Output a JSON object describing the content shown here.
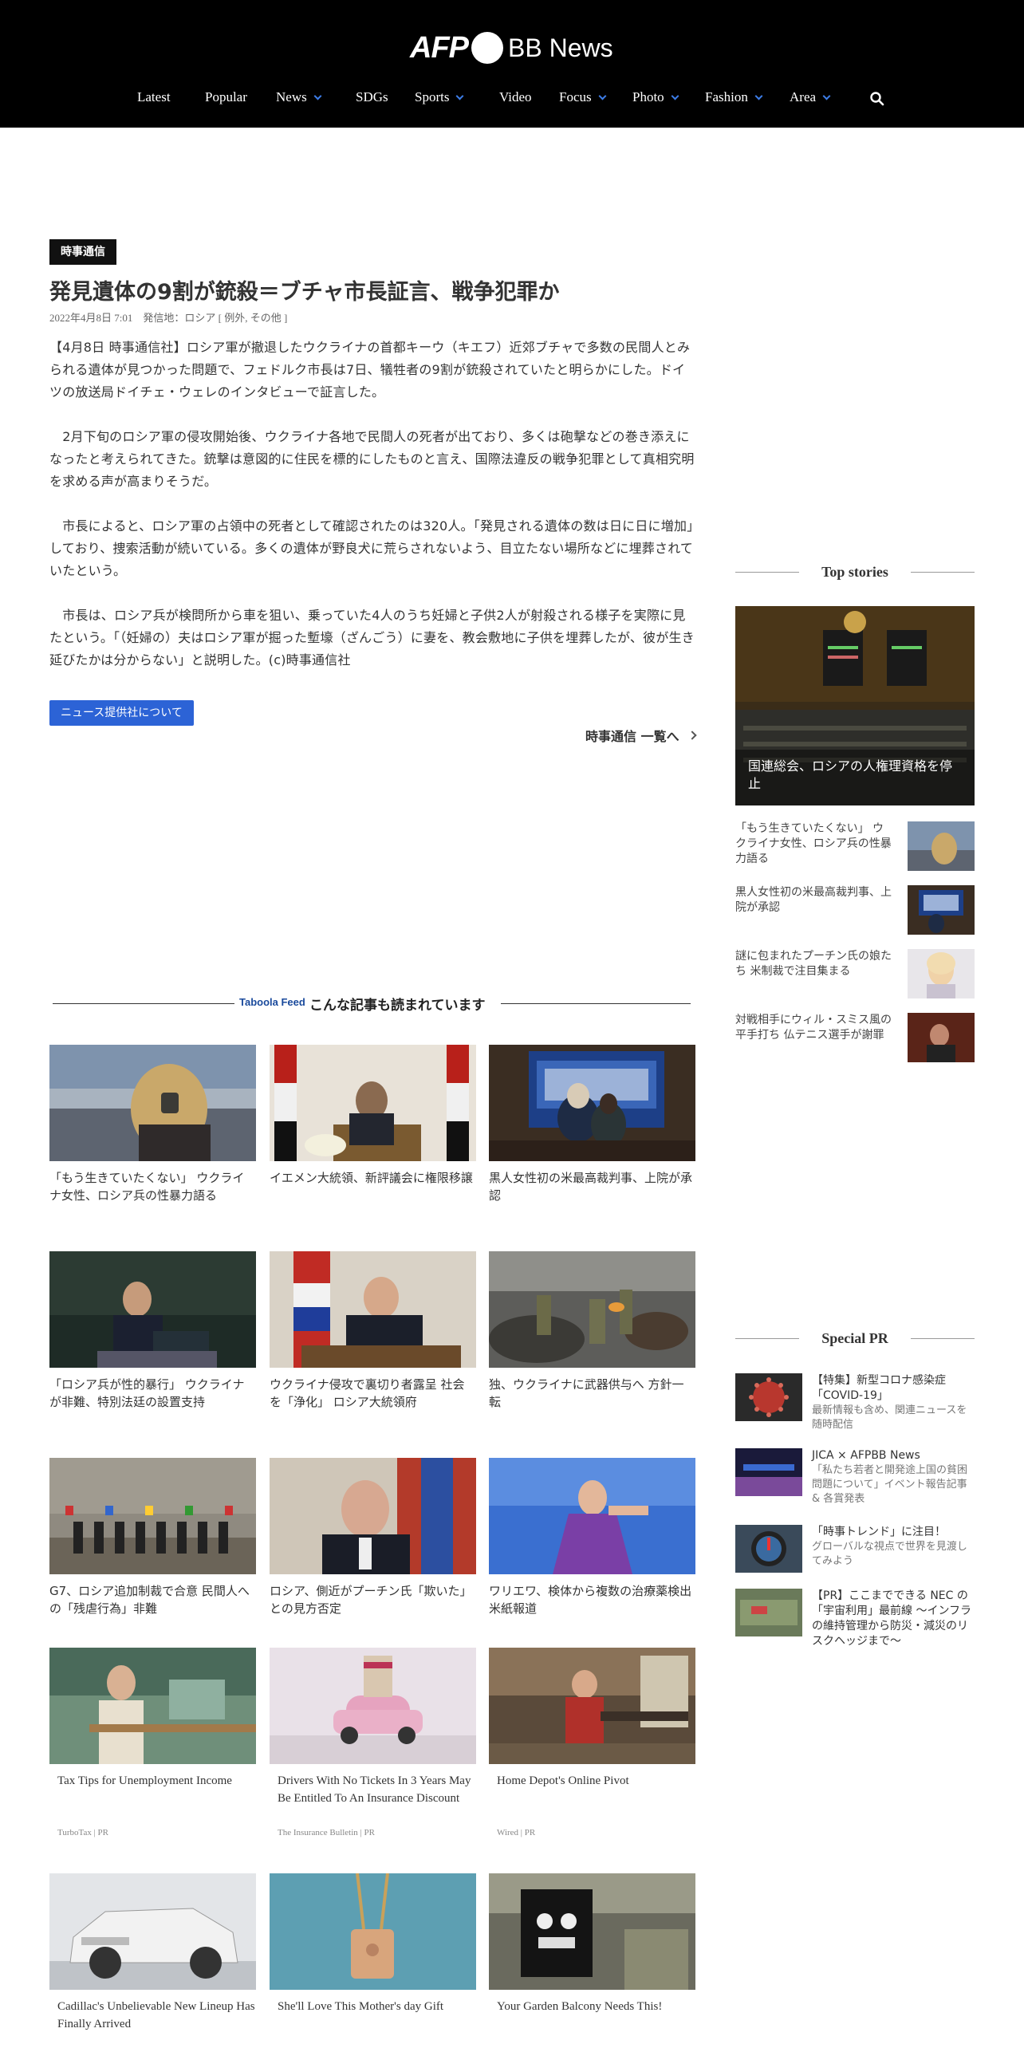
{
  "header": {
    "logo_afp": "AFP",
    "logo_bb": "BB News",
    "nav": [
      {
        "label": "Latest",
        "dropdown": false
      },
      {
        "label": "Popular",
        "dropdown": false
      },
      {
        "label": "News",
        "dropdown": true
      },
      {
        "label": "SDGs",
        "dropdown": false
      },
      {
        "label": "Sports",
        "dropdown": true
      },
      {
        "label": "Video",
        "dropdown": false
      },
      {
        "label": "Focus",
        "dropdown": true
      },
      {
        "label": "Photo",
        "dropdown": true
      },
      {
        "label": "Fashion",
        "dropdown": true
      },
      {
        "label": "Area",
        "dropdown": true
      }
    ],
    "search_icon": "search-icon"
  },
  "article": {
    "badge": "時事通信",
    "title": "発見遺体の9割が銃殺＝ブチャ市長証言、戦争犯罪か",
    "meta": "2022年4月8日 7:01　発信地：ロシア [ 例外, その他 ]",
    "paragraphs": [
      "【4月8日 時事通信社】ロシア軍が撤退したウクライナの首都キーウ（キエフ）近郊ブチャで多数の民間人とみられる遺体が見つかった問題で、フェドルク市長は7日、犠牲者の9割が銃殺されていたと明らかにした。ドイツの放送局ドイチェ・ウェレのインタビューで証言した。",
      "　2月下旬のロシア軍の侵攻開始後、ウクライナ各地で民間人の死者が出ており、多くは砲撃などの巻き添えになったと考えられてきた。銃撃は意図的に住民を標的にしたものと言え、国際法違反の戦争犯罪として真相究明を求める声が高まりそうだ。",
      "　市長によると、ロシア軍の占領中の死者として確認されたのは320人。「発見される遺体の数は日に日に増加」しており、捜索活動が続いている。多くの遺体が野良犬に荒らされないよう、目立たない場所などに埋葬されていたという。",
      "　市長は、ロシア兵が検問所から車を狙い、乗っていた4人のうち妊婦と子供2人が射殺される様子を実際に見たという。「（妊婦の）夫はロシア軍が掘った塹壕（ざんごう）に妻を、教会敷地に子供を埋葬したが、彼が生き延びたかは分からない」と説明した。(c)時事通信社"
    ],
    "provider_button": "ニュース提供社について",
    "more_link": "時事通信 一覧へ"
  },
  "taboola": {
    "logo": "Taboola Feed",
    "title": "こんな記事も読まれています",
    "cards": [
      {
        "caption": "「もう生きていたくない」 ウクライナ女性、ロシア兵の性暴力語る"
      },
      {
        "caption": "イエメン大統領、新評議会に権限移譲"
      },
      {
        "caption": "黒人女性初の米最高裁判事、上院が承認"
      },
      {
        "caption": "「ロシア兵が性的暴行」 ウクライナが非難、特別法廷の設置支持"
      },
      {
        "caption": "ウクライナ侵攻で裏切り者露呈 社会を「浄化」 ロシア大統領府"
      },
      {
        "caption": "独、ウクライナに武器供与へ 方針一転"
      },
      {
        "caption": "G7、ロシア追加制裁で合意 民間人への「残虐行為」非難"
      },
      {
        "caption": "ロシア、側近がプーチン氏「欺いた」との見方否定"
      },
      {
        "caption": "ワリエワ、検体から複数の治療薬検出 米紙報道"
      },
      {
        "caption": "Tax Tips for Unemployment Income",
        "source": "TurboTax | PR"
      },
      {
        "caption": "Drivers With No Tickets In 3 Years May Be Entitled To An Insurance Discount",
        "source": "The Insurance Bulletin | PR"
      },
      {
        "caption": "Home Depot's Online Pivot",
        "source": "Wired | PR"
      },
      {
        "caption": "Cadillac's Unbelievable New Lineup Has Finally Arrived"
      },
      {
        "caption": "She'll Love This Mother's day Gift"
      },
      {
        "caption": "Your Garden Balcony Needs This!"
      }
    ]
  },
  "sidebar": {
    "top_stories_title": "Top stories",
    "top_story": "国連総会、ロシアの人権理資格を停止",
    "items": [
      {
        "text": "「もう生きていたくない」 ウクライナ女性、ロシア兵の性暴力語る"
      },
      {
        "text": "黒人女性初の米最高裁判事、上院が承認"
      },
      {
        "text": "謎に包まれたプーチン氏の娘たち 米制裁で注目集まる"
      },
      {
        "text": "対戦相手にウィル・スミス風の平手打ち 仏テニス選手が謝罪"
      }
    ],
    "special_pr_title": "Special PR",
    "pr_items": [
      {
        "title": "【特集】新型コロナ感染症「COVID-19」",
        "sub": "最新情報も含め、関連ニュースを随時配信"
      },
      {
        "title": "JICA × AFPBB News",
        "sub": "「私たち若者と開発途上国の貧困問題について」イベント報告記事 & 各賞発表"
      },
      {
        "title": "「時事トレンド」に注目！",
        "sub": "グローバルな視点で世界を見渡してみよう"
      },
      {
        "title": "【PR】ここまでできる NEC の「宇宙利用」最前線 ～インフラの維持管理から防災・減災のリスクヘッジまで～",
        "sub": ""
      }
    ]
  },
  "colors": {
    "header_bg": "#000000",
    "accent_blue": "#2c63d6",
    "nav_chevron": "#3d7de8"
  }
}
